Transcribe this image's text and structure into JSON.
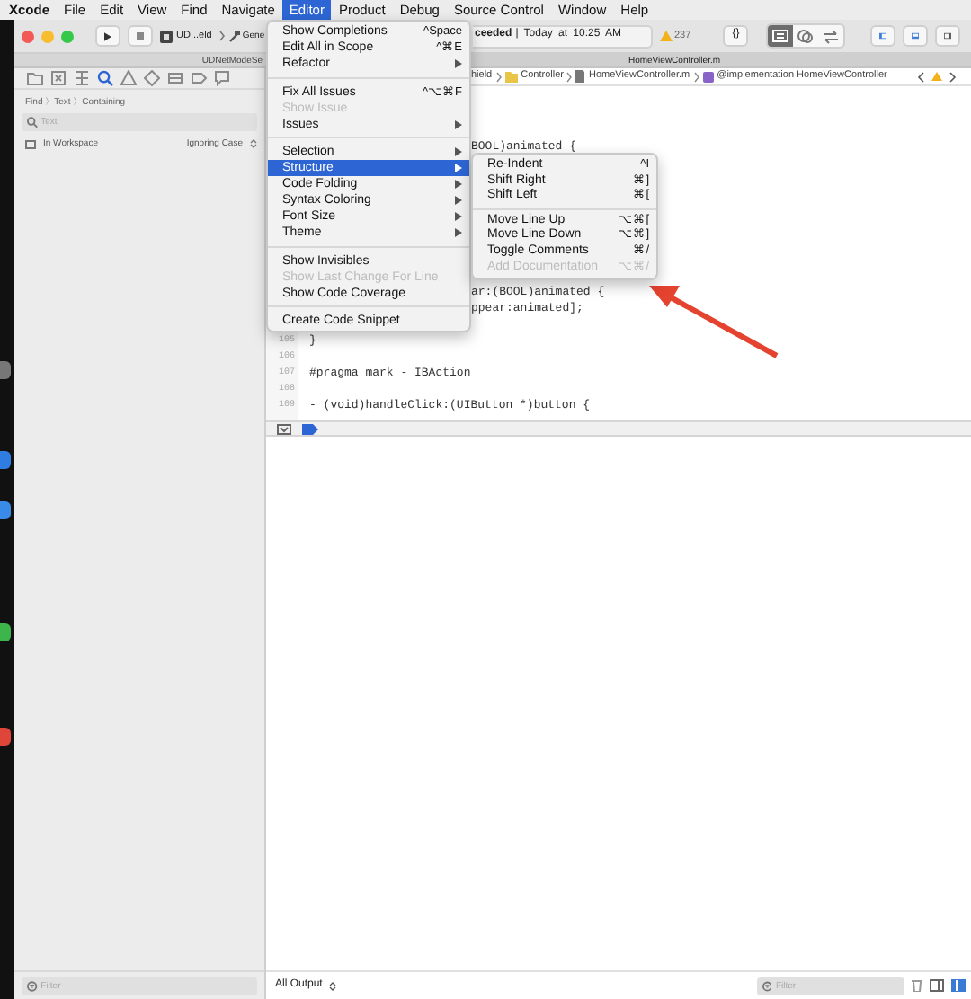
{
  "menubar": [
    {
      "label": "Xcode",
      "kind": "app",
      "selected": false
    },
    {
      "label": "File",
      "kind": "menu",
      "selected": false
    },
    {
      "label": "Edit",
      "kind": "menu",
      "selected": false
    },
    {
      "label": "View",
      "kind": "menu",
      "selected": false
    },
    {
      "label": "Find",
      "kind": "menu",
      "selected": false
    },
    {
      "label": "Navigate",
      "kind": "menu",
      "selected": false
    },
    {
      "label": "Editor",
      "kind": "menu",
      "selected": true
    },
    {
      "label": "Product",
      "kind": "menu",
      "selected": false
    },
    {
      "label": "Debug",
      "kind": "menu",
      "selected": false
    },
    {
      "label": "Source Control",
      "kind": "menu",
      "selected": false
    },
    {
      "label": "Window",
      "kind": "menu",
      "selected": false
    },
    {
      "label": "Help",
      "kind": "menu",
      "selected": false
    }
  ],
  "toolbar": {
    "scheme": "UD...eld",
    "destination": "Gene",
    "status": "**ceeded** | Today at 10:25 AM",
    "warnings": "237",
    "code_button": "{}",
    "editor_modes": [
      {
        "selected": true
      },
      {
        "selected": false
      },
      {
        "selected": false
      }
    ],
    "panels": [
      {
        "on": true
      },
      {
        "on": true
      },
      {
        "on": false
      }
    ]
  },
  "tabs": [
    {
      "label": "UDNetModeSe",
      "selected": false
    },
    {
      "label": "HomeViewController.m",
      "selected": true
    }
  ],
  "navigator": {
    "tabs": [
      {
        "selected": false
      },
      {
        "selected": false
      },
      {
        "selected": false
      },
      {
        "selected": true
      },
      {
        "selected": false
      },
      {
        "selected": false
      },
      {
        "selected": false
      },
      {
        "selected": false
      },
      {
        "selected": false
      }
    ],
    "breadcrumb": "Find 〉Text 〉Containing",
    "search": {
      "placeholder": "Text"
    },
    "scope": "In Workspace",
    "matching": "Ignoring Case",
    "filter": {
      "placeholder": "Filter"
    }
  },
  "jump_bar": [
    "hield",
    "Controller",
    "HomeViewController.m",
    "@implementation HomeViewController"
  ],
  "code_lines": [
    {
      "text": "BOOL)animated {"
    },
    {
      "text": "ar:(BOOL)animated {"
    },
    {
      "text": "ppear:animated];"
    },
    {
      "number": "105",
      "text": "}"
    },
    {
      "number": "106"
    },
    {
      "number": "107",
      "text": "#pragma mark - IBAction"
    },
    {
      "number": "108"
    },
    {
      "number": "109",
      "text": "- (void)handleClick:(UIButton *)button {"
    }
  ],
  "console": {
    "output": "All Output",
    "filter": {
      "placeholder": "Filter"
    },
    "views": [
      {
        "on": false
      },
      {
        "on": true
      }
    ]
  },
  "editor_menu": [
    {
      "kind": "item",
      "label": "Show Completions",
      "shortcut": "^Space",
      "submenu": false,
      "disabled": false,
      "selected": false
    },
    {
      "kind": "item",
      "label": "Edit All in Scope",
      "shortcut": "^⌘E",
      "submenu": false,
      "disabled": false,
      "selected": false
    },
    {
      "kind": "item",
      "label": "Refactor",
      "submenu": true,
      "disabled": false,
      "selected": false
    },
    {
      "kind": "separator"
    },
    {
      "kind": "item",
      "label": "Fix All Issues",
      "shortcut": "^⌥⌘F",
      "submenu": false,
      "disabled": false,
      "selected": false
    },
    {
      "kind": "item",
      "label": "Show Issue",
      "submenu": false,
      "disabled": true,
      "selected": false
    },
    {
      "kind": "item",
      "label": "Issues",
      "submenu": true,
      "disabled": false,
      "selected": false
    },
    {
      "kind": "separator"
    },
    {
      "kind": "item",
      "label": "Selection",
      "submenu": true,
      "disabled": false,
      "selected": false
    },
    {
      "kind": "item",
      "label": "Structure",
      "submenu": true,
      "disabled": false,
      "selected": true,
      "items": [
        {
          "kind": "item",
          "label": "Re-Indent",
          "shortcut": "^I",
          "disabled": false,
          "selected": false
        },
        {
          "kind": "item",
          "label": "Shift Right",
          "shortcut": "⌘]",
          "disabled": false,
          "selected": false
        },
        {
          "kind": "item",
          "label": "Shift Left",
          "shortcut": "⌘[",
          "disabled": false,
          "selected": false
        },
        {
          "kind": "separator"
        },
        {
          "kind": "item",
          "label": "Move Line Up",
          "shortcut": "⌥⌘[",
          "disabled": false,
          "selected": false
        },
        {
          "kind": "item",
          "label": "Move Line Down",
          "shortcut": "⌥⌘]",
          "disabled": false,
          "selected": false
        },
        {
          "kind": "item",
          "label": "Toggle Comments",
          "shortcut": "⌘/",
          "disabled": false,
          "selected": false
        },
        {
          "kind": "item",
          "label": "Add Documentation",
          "shortcut": "⌥⌘/",
          "disabled": true,
          "selected": false
        }
      ]
    },
    {
      "kind": "item",
      "label": "Code Folding",
      "submenu": true,
      "disabled": false,
      "selected": false
    },
    {
      "kind": "item",
      "label": "Syntax Coloring",
      "submenu": true,
      "disabled": false,
      "selected": false
    },
    {
      "kind": "item",
      "label": "Font Size",
      "submenu": true,
      "disabled": false,
      "selected": false
    },
    {
      "kind": "item",
      "label": "Theme",
      "submenu": true,
      "disabled": false,
      "selected": false
    },
    {
      "kind": "separator"
    },
    {
      "kind": "item",
      "label": "Show Invisibles",
      "submenu": false,
      "disabled": false,
      "selected": false
    },
    {
      "kind": "item",
      "label": "Show Last Change For Line",
      "submenu": false,
      "disabled": true,
      "selected": false
    },
    {
      "kind": "item",
      "label": "Show Code Coverage",
      "submenu": false,
      "disabled": false,
      "selected": false
    },
    {
      "kind": "separator"
    },
    {
      "kind": "item",
      "label": "Create Code Snippet",
      "submenu": false,
      "disabled": false,
      "selected": false
    }
  ]
}
